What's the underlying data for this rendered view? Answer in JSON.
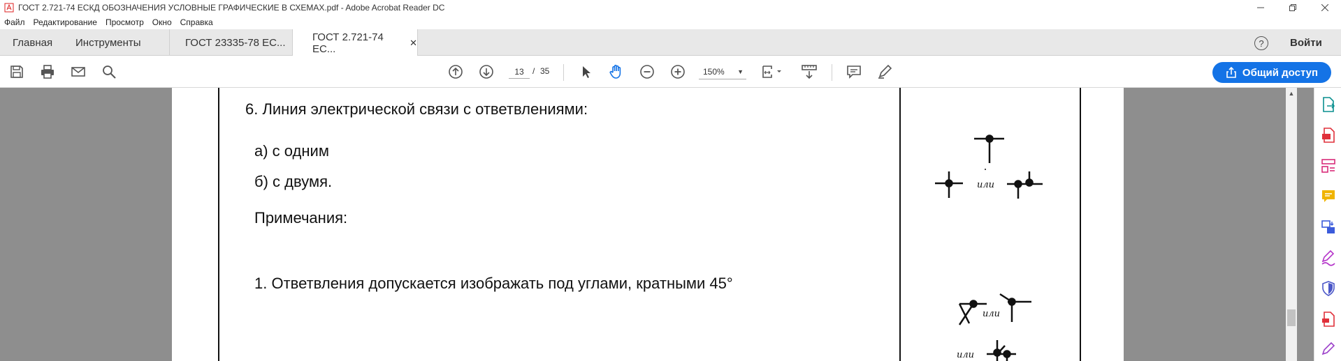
{
  "window": {
    "title": "ГОСТ 2.721-74 ЕСКД ОБОЗНАЧЕНИЯ УСЛОВНЫЕ ГРАФИЧЕСКИЕ В СХЕМАХ.pdf - Adobe Acrobat Reader DC"
  },
  "menu": [
    "Файл",
    "Редактирование",
    "Просмотр",
    "Окно",
    "Справка"
  ],
  "tabs": {
    "home": "Главная",
    "tools": "Инструменты",
    "doc1": "ГОСТ 23335-78 ЕС...",
    "doc2": "ГОСТ 2.721-74 ЕС..."
  },
  "header": {
    "help": "?",
    "login": "Войти"
  },
  "toolbar": {
    "current_page": "13",
    "separator": "/",
    "total_pages": "35",
    "zoom": "150%",
    "share_label": "Общий доступ"
  },
  "document": {
    "heading": "6. Линия электрической связи с ответвлениями:",
    "item_a": "а) с одним",
    "item_b": "б) с двумя.",
    "notes_title": "Примечания:",
    "note_1": "1. Ответвления допускается изображать под углами, кратными 45°",
    "symbol_or_1": "или",
    "symbol_or_2": "или",
    "symbol_or_3": "или"
  },
  "colors": {
    "accent": "#1473e6",
    "viewer_bg": "#8e8e8e",
    "tab_bar": "#e8e8e8"
  }
}
